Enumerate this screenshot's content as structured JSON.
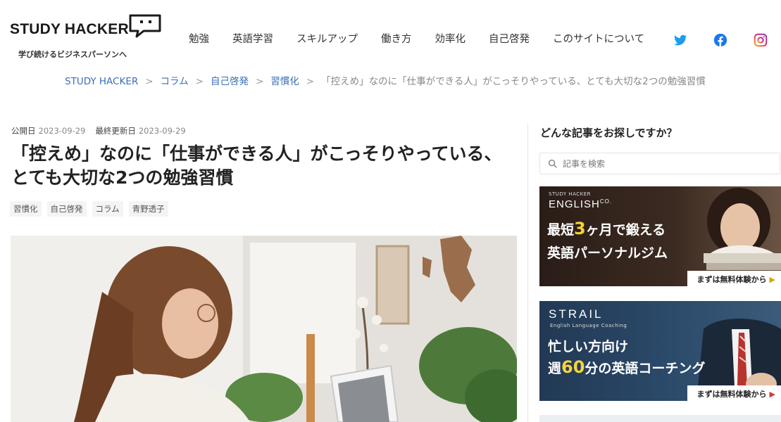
{
  "header": {
    "logo_text": "STUDY HACKER",
    "tagline": "学び続けるビジネスパーソンへ",
    "nav": [
      "勉強",
      "英語学習",
      "スキルアップ",
      "働き方",
      "効率化",
      "自己啓発",
      "このサイトについて"
    ],
    "social": [
      "twitter-icon",
      "facebook-icon",
      "instagram-icon"
    ]
  },
  "breadcrumb": {
    "items": [
      "STUDY HACKER",
      "コラム",
      "自己啓発",
      "習慣化"
    ],
    "separator": ">",
    "current": "「控えめ」なのに「仕事ができる人」がこっそりやっている、とても大切な2つの勉強習慣"
  },
  "article": {
    "published_label": "公開日",
    "published_date": "2023-09-29",
    "updated_label": "最終更新日",
    "updated_date": "2023-09-29",
    "title": "「控えめ」なのに「仕事ができる人」がこっそりやっている、とても大切な2つの勉強習慣",
    "tags": [
      "習慣化",
      "自己啓発",
      "コラム",
      "青野透子"
    ]
  },
  "sidebar": {
    "title": "どんな記事をお探しですか？",
    "search_placeholder": "記事を検索",
    "ad1": {
      "small": "STUDY HACKER",
      "brand": "ENGLISH",
      "brand_suffix": "CO.",
      "line1_pre": "最短",
      "line1_num": "3",
      "line1_post": "ヶ月で鍛える",
      "line2": "英語パーソナルジム",
      "cta": "まずは無料体験から"
    },
    "ad2": {
      "brand": "STRAIL",
      "small": "English Language Coaching",
      "line1": "忙しい方向け",
      "line2_pre": "週",
      "line2_num": "60",
      "line2_post": "分の英語コーチング",
      "cta": "まずは無料体験から"
    }
  },
  "colors": {
    "link": "#3a6fb5",
    "twitter": "#1d9bf0",
    "facebook": "#1877f2",
    "instagram": "#e1306c",
    "accent_yellow": "#f5d33c"
  }
}
